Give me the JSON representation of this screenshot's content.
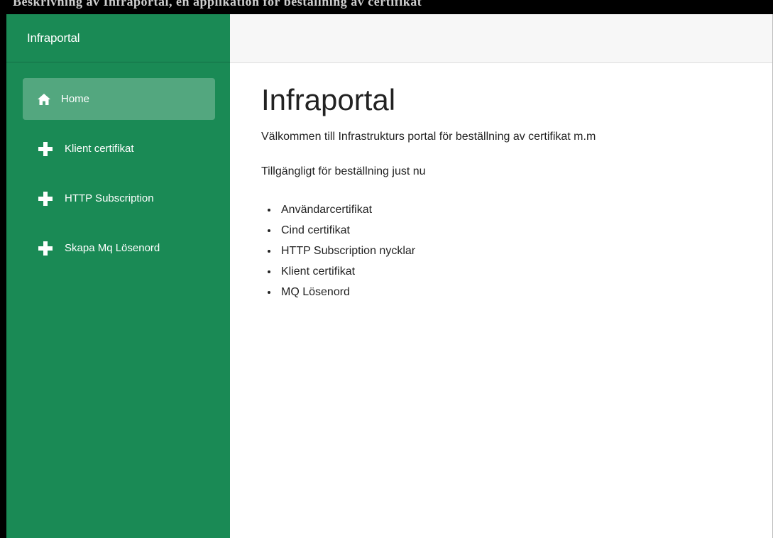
{
  "overlay": {
    "heading_text": "Beskrivning av Infraportal, en applikation för beställning av certifikat"
  },
  "sidebar": {
    "brand": "Infraportal",
    "items": [
      {
        "label": "Home",
        "icon": "home-icon",
        "active": true
      },
      {
        "label": "Klient certifikat",
        "icon": "plus-icon",
        "active": false
      },
      {
        "label": "HTTP Subscription",
        "icon": "plus-icon",
        "active": false
      },
      {
        "label": "Skapa Mq Lösenord",
        "icon": "plus-icon",
        "active": false
      }
    ]
  },
  "main": {
    "title": "Infraportal",
    "welcome": "Välkommen till Infrastrukturs portal för beställning av certifikat m.m",
    "available_heading": "Tillgängligt för beställning just nu",
    "available_items": [
      "Användarcertifikat",
      "Cind certifikat",
      "HTTP Subscription nycklar",
      "Klient certifikat",
      "MQ Lösenord"
    ]
  },
  "colors": {
    "sidebar_bg": "#1a8a55",
    "active_item_bg": "#5aae84",
    "topbar_bg": "#f7f7f7",
    "text": "#222222"
  }
}
